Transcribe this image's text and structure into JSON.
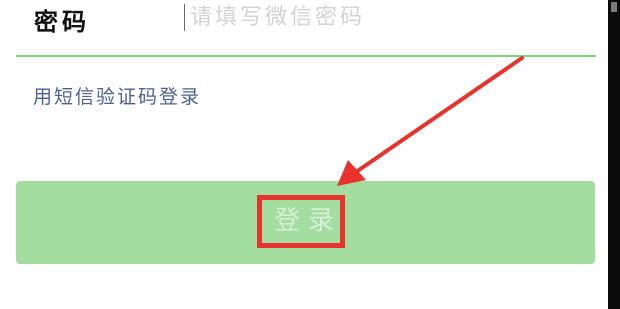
{
  "form": {
    "password_label": "密码",
    "password_placeholder": "请填写微信密码",
    "password_value": "",
    "sms_login_link": "用短信验证码登录",
    "login_button_label": "登录"
  },
  "annotation": {
    "color": "#e8322c"
  },
  "colors": {
    "underline": "#7fd27f",
    "button_bg": "#a3dea0",
    "link": "#4d5f93"
  }
}
